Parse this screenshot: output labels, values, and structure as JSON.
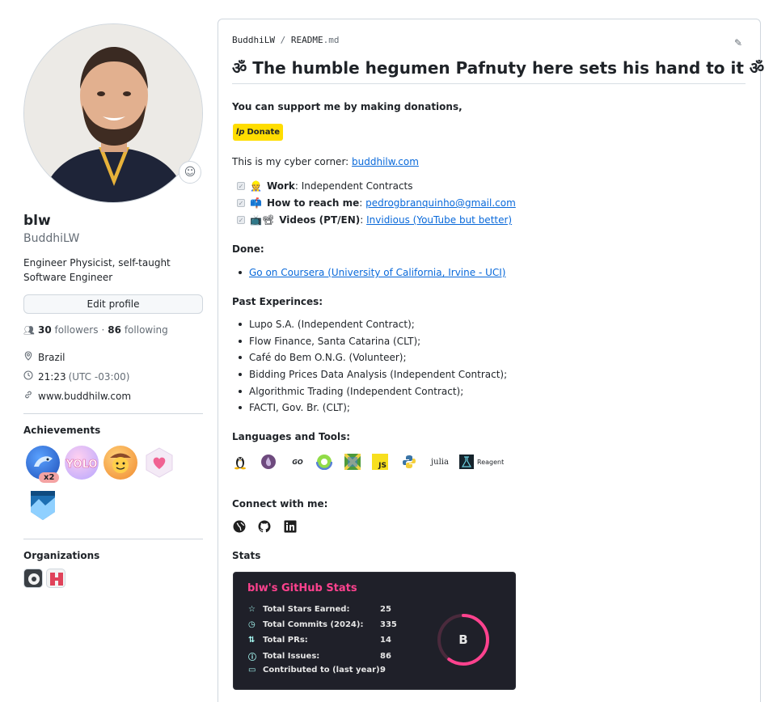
{
  "profile": {
    "fullname": "blw",
    "login": "BuddhiLW",
    "bio": "Engineer Physicist, self-taught Software Engineer",
    "edit_label": "Edit profile",
    "followers_count": "30",
    "followers_label": "followers",
    "separator": "·",
    "following_count": "86",
    "following_label": "following",
    "location": "Brazil",
    "time": "21:23",
    "timezone": "(UTC -03:00)",
    "website": "www.buddhilw.com"
  },
  "achievements": {
    "title": "Achievements",
    "multiplier": "x2"
  },
  "organizations": {
    "title": "Organizations"
  },
  "readme": {
    "owner": "BuddhiLW",
    "slash": "/",
    "file_base": "README",
    "file_ext": ".md",
    "heading": "ॐ The humble hegumen Pafnuty here sets his hand to it ॐ",
    "support": "You can support me by making donations,",
    "donate_label": "Donate",
    "cyber_prefix": "This is my cyber corner: ",
    "cyber_link": "buddhilw.com",
    "tasks": [
      {
        "emoji": "👷",
        "label": "Work",
        "sep": ": ",
        "text": "Independent Contracts",
        "link": ""
      },
      {
        "emoji": "📫",
        "label": "How to reach me",
        "sep": ": ",
        "text": "",
        "link": "pedrogbranquinho@gmail.com"
      },
      {
        "emoji": "📺📽",
        "label": "Videos (PT/EN)",
        "sep": ": ",
        "text": "",
        "link": "Invidious (YouTube but better)"
      }
    ],
    "done_title": "Done:",
    "done_items": [
      "Go on Coursera (University of California, Irvine - UCI)"
    ],
    "past_title": "Past Experinces:",
    "past_items": [
      "Lupo S.A. (Independent Contract);",
      "Flow Finance, Santa Catarina (CLT);",
      "Café do Bem O.N.G. (Volunteer);",
      "Bidding Prices Data Analysis (Independent Contract);",
      "Algorithmic Trading (Independent Contract);",
      "FACTI, Gov. Br. (CLT);"
    ],
    "tools_title": "Languages and Tools:",
    "tools": [
      "linux",
      "elixir",
      "go",
      "clojure",
      "jsx",
      "javascript",
      "python",
      "julia",
      "reagent"
    ],
    "julia_text": "julia",
    "go_text": "GO",
    "js_text": "JS",
    "reagent_text": "Reagent",
    "connect_title": "Connect with me:",
    "stats_heading": "Stats"
  },
  "stats": {
    "title": "blw's GitHub Stats",
    "rows": [
      {
        "label": "Total Stars Earned:",
        "value": "25",
        "icon": "☆"
      },
      {
        "label": "Total Commits (2024):",
        "value": "335",
        "icon": "◷"
      },
      {
        "label": "Total PRs:",
        "value": "14",
        "icon": "⇅"
      },
      {
        "label": "Total Issues:",
        "value": "86",
        "icon": "ⓘ"
      },
      {
        "label": "Contributed to (last year):",
        "value": "9",
        "icon": "▭"
      }
    ],
    "grade": "B",
    "grade_progress": 0.6,
    "colors": {
      "title": "#fe428e",
      "icon": "#a9fef7",
      "ring": "#fe428e",
      "bg": "#1f2029"
    }
  }
}
